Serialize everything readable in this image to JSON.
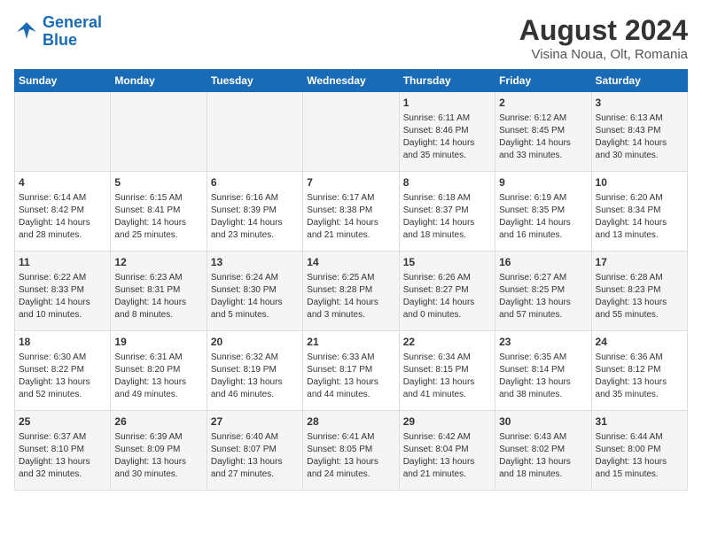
{
  "logo": {
    "line1": "General",
    "line2": "Blue"
  },
  "title": "August 2024",
  "location": "Visina Noua, Olt, Romania",
  "days_of_week": [
    "Sunday",
    "Monday",
    "Tuesday",
    "Wednesday",
    "Thursday",
    "Friday",
    "Saturday"
  ],
  "weeks": [
    [
      {
        "day": "",
        "info": ""
      },
      {
        "day": "",
        "info": ""
      },
      {
        "day": "",
        "info": ""
      },
      {
        "day": "",
        "info": ""
      },
      {
        "day": "1",
        "info": "Sunrise: 6:11 AM\nSunset: 8:46 PM\nDaylight: 14 hours\nand 35 minutes."
      },
      {
        "day": "2",
        "info": "Sunrise: 6:12 AM\nSunset: 8:45 PM\nDaylight: 14 hours\nand 33 minutes."
      },
      {
        "day": "3",
        "info": "Sunrise: 6:13 AM\nSunset: 8:43 PM\nDaylight: 14 hours\nand 30 minutes."
      }
    ],
    [
      {
        "day": "4",
        "info": "Sunrise: 6:14 AM\nSunset: 8:42 PM\nDaylight: 14 hours\nand 28 minutes."
      },
      {
        "day": "5",
        "info": "Sunrise: 6:15 AM\nSunset: 8:41 PM\nDaylight: 14 hours\nand 25 minutes."
      },
      {
        "day": "6",
        "info": "Sunrise: 6:16 AM\nSunset: 8:39 PM\nDaylight: 14 hours\nand 23 minutes."
      },
      {
        "day": "7",
        "info": "Sunrise: 6:17 AM\nSunset: 8:38 PM\nDaylight: 14 hours\nand 21 minutes."
      },
      {
        "day": "8",
        "info": "Sunrise: 6:18 AM\nSunset: 8:37 PM\nDaylight: 14 hours\nand 18 minutes."
      },
      {
        "day": "9",
        "info": "Sunrise: 6:19 AM\nSunset: 8:35 PM\nDaylight: 14 hours\nand 16 minutes."
      },
      {
        "day": "10",
        "info": "Sunrise: 6:20 AM\nSunset: 8:34 PM\nDaylight: 14 hours\nand 13 minutes."
      }
    ],
    [
      {
        "day": "11",
        "info": "Sunrise: 6:22 AM\nSunset: 8:33 PM\nDaylight: 14 hours\nand 10 minutes."
      },
      {
        "day": "12",
        "info": "Sunrise: 6:23 AM\nSunset: 8:31 PM\nDaylight: 14 hours\nand 8 minutes."
      },
      {
        "day": "13",
        "info": "Sunrise: 6:24 AM\nSunset: 8:30 PM\nDaylight: 14 hours\nand 5 minutes."
      },
      {
        "day": "14",
        "info": "Sunrise: 6:25 AM\nSunset: 8:28 PM\nDaylight: 14 hours\nand 3 minutes."
      },
      {
        "day": "15",
        "info": "Sunrise: 6:26 AM\nSunset: 8:27 PM\nDaylight: 14 hours\nand 0 minutes."
      },
      {
        "day": "16",
        "info": "Sunrise: 6:27 AM\nSunset: 8:25 PM\nDaylight: 13 hours\nand 57 minutes."
      },
      {
        "day": "17",
        "info": "Sunrise: 6:28 AM\nSunset: 8:23 PM\nDaylight: 13 hours\nand 55 minutes."
      }
    ],
    [
      {
        "day": "18",
        "info": "Sunrise: 6:30 AM\nSunset: 8:22 PM\nDaylight: 13 hours\nand 52 minutes."
      },
      {
        "day": "19",
        "info": "Sunrise: 6:31 AM\nSunset: 8:20 PM\nDaylight: 13 hours\nand 49 minutes."
      },
      {
        "day": "20",
        "info": "Sunrise: 6:32 AM\nSunset: 8:19 PM\nDaylight: 13 hours\nand 46 minutes."
      },
      {
        "day": "21",
        "info": "Sunrise: 6:33 AM\nSunset: 8:17 PM\nDaylight: 13 hours\nand 44 minutes."
      },
      {
        "day": "22",
        "info": "Sunrise: 6:34 AM\nSunset: 8:15 PM\nDaylight: 13 hours\nand 41 minutes."
      },
      {
        "day": "23",
        "info": "Sunrise: 6:35 AM\nSunset: 8:14 PM\nDaylight: 13 hours\nand 38 minutes."
      },
      {
        "day": "24",
        "info": "Sunrise: 6:36 AM\nSunset: 8:12 PM\nDaylight: 13 hours\nand 35 minutes."
      }
    ],
    [
      {
        "day": "25",
        "info": "Sunrise: 6:37 AM\nSunset: 8:10 PM\nDaylight: 13 hours\nand 32 minutes."
      },
      {
        "day": "26",
        "info": "Sunrise: 6:39 AM\nSunset: 8:09 PM\nDaylight: 13 hours\nand 30 minutes."
      },
      {
        "day": "27",
        "info": "Sunrise: 6:40 AM\nSunset: 8:07 PM\nDaylight: 13 hours\nand 27 minutes."
      },
      {
        "day": "28",
        "info": "Sunrise: 6:41 AM\nSunset: 8:05 PM\nDaylight: 13 hours\nand 24 minutes."
      },
      {
        "day": "29",
        "info": "Sunrise: 6:42 AM\nSunset: 8:04 PM\nDaylight: 13 hours\nand 21 minutes."
      },
      {
        "day": "30",
        "info": "Sunrise: 6:43 AM\nSunset: 8:02 PM\nDaylight: 13 hours\nand 18 minutes."
      },
      {
        "day": "31",
        "info": "Sunrise: 6:44 AM\nSunset: 8:00 PM\nDaylight: 13 hours\nand 15 minutes."
      }
    ]
  ]
}
